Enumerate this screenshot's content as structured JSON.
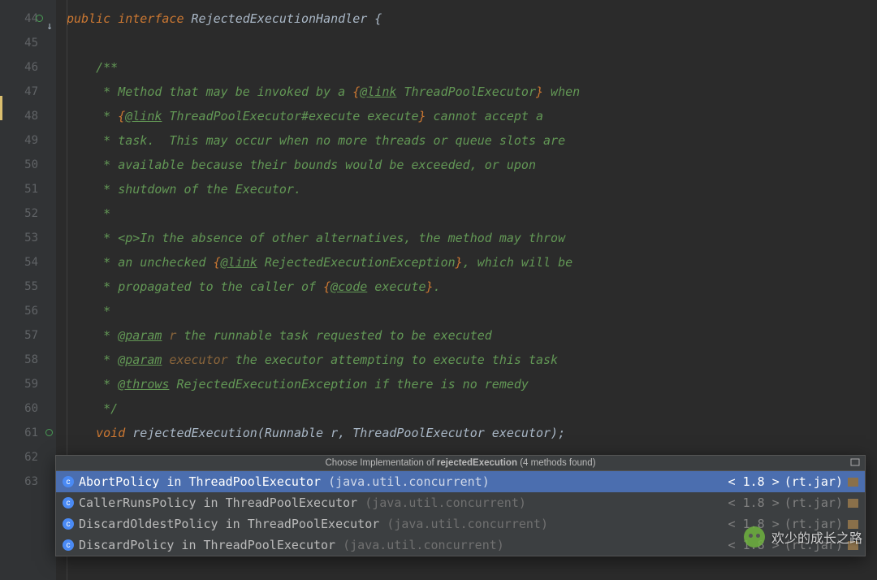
{
  "gutter": {
    "start": 44,
    "end": 63
  },
  "code": {
    "l44_public": "public",
    "l44_interface": "interface",
    "l44_name": " RejectedExecutionHandler {",
    "l46": "/**",
    "l47_a": " * Method that may be invoked by a ",
    "l47_b": "{",
    "l47_c": "@link",
    "l47_d": " ThreadPoolExecutor",
    "l47_e": "}",
    "l47_f": " when",
    "l48_a": " * ",
    "l48_b": "{",
    "l48_c": "@link",
    "l48_d": " ThreadPoolExecutor#execute execute",
    "l48_e": "}",
    "l48_f": " cannot accept a",
    "l49": " * task.  This may occur when no more threads or queue slots are",
    "l50": " * available because their bounds would be exceeded, or upon",
    "l51": " * shutdown of the Executor.",
    "l52": " *",
    "l53": " * <p>In the absence of other alternatives, the method may throw",
    "l54_a": " * an unchecked ",
    "l54_b": "{",
    "l54_c": "@link",
    "l54_d": " RejectedExecutionException",
    "l54_e": "}",
    "l54_f": ", which will be",
    "l55_a": " * propagated to the caller of ",
    "l55_b": "{",
    "l55_c": "@code",
    "l55_d": " execute",
    "l55_e": "}",
    "l55_f": ".",
    "l56": " *",
    "l57_a": " * ",
    "l57_b": "@param",
    "l57_c": " r",
    "l57_d": " the runnable task requested to be executed",
    "l58_a": " * ",
    "l58_b": "@param",
    "l58_c": " executor",
    "l58_d": " the executor attempting to execute this task",
    "l59_a": " * ",
    "l59_b": "@throws",
    "l59_c": " RejectedExecutionException ",
    "l59_d": "if there is no remedy",
    "l60": " */",
    "l61_a": "void",
    "l61_b": " rejectedExecution(Runnable r, ThreadPoolExecutor executor);"
  },
  "popup": {
    "title_prefix": "Choose Implementation of ",
    "title_bold": "rejectedExecution",
    "title_suffix": " (4 methods found)",
    "items": [
      {
        "class": "AbortPolicy",
        "in": " in ThreadPoolExecutor ",
        "pkg": "(java.util.concurrent)",
        "ver": "< 1.8 >",
        "jar": "(rt.jar)",
        "selected": true
      },
      {
        "class": "CallerRunsPolicy",
        "in": " in ThreadPoolExecutor ",
        "pkg": "(java.util.concurrent)",
        "ver": "< 1.8 >",
        "jar": "(rt.jar)",
        "selected": false
      },
      {
        "class": "DiscardOldestPolicy",
        "in": " in ThreadPoolExecutor ",
        "pkg": "(java.util.concurrent)",
        "ver": "< 1.8 >",
        "jar": "(rt.jar)",
        "selected": false
      },
      {
        "class": "DiscardPolicy",
        "in": " in ThreadPoolExecutor ",
        "pkg": "(java.util.concurrent)",
        "ver": "< 1.8 >",
        "jar": "(rt.jar)",
        "selected": false
      }
    ]
  },
  "watermark": "欢少的成长之路"
}
